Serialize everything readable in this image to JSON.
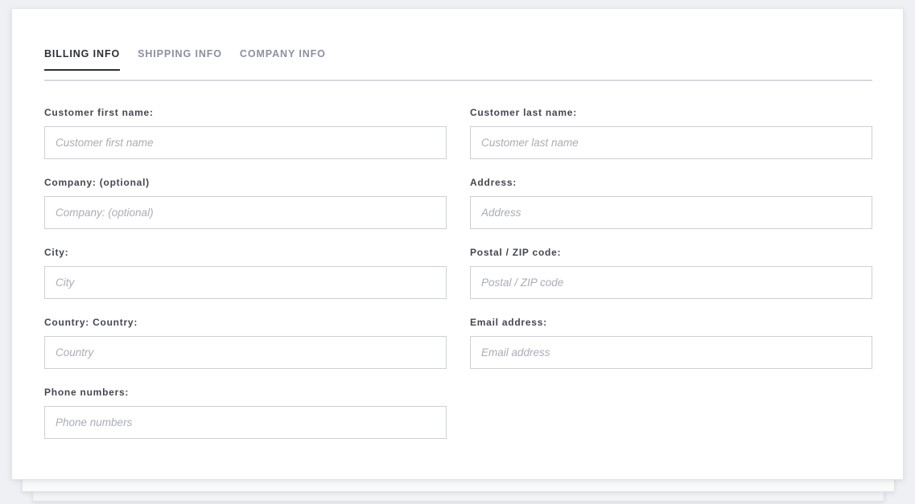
{
  "tabs": [
    {
      "label": "BILLING INFO",
      "name": "tab-billing-info",
      "active": true
    },
    {
      "label": "SHIPPING INFO",
      "name": "tab-shipping-info",
      "active": false
    },
    {
      "label": "COMPANY INFO",
      "name": "tab-company-info",
      "active": false
    }
  ],
  "form": {
    "left_column": [
      {
        "name": "customer-first-name",
        "label": "Customer first name:",
        "placeholder": "Customer first name",
        "value": ""
      },
      {
        "name": "company-optional",
        "label": "Company: (optional)",
        "placeholder": "Company: (optional)",
        "value": ""
      },
      {
        "name": "city",
        "label": "City:",
        "placeholder": "City",
        "value": ""
      },
      {
        "name": "country",
        "label": "Country: Country:",
        "placeholder": "Country",
        "value": ""
      },
      {
        "name": "phone-numbers",
        "label": "Phone numbers:",
        "placeholder": "Phone numbers",
        "value": ""
      }
    ],
    "right_column": [
      {
        "name": "customer-last-name",
        "label": "Customer last name:",
        "placeholder": "Customer last name",
        "value": ""
      },
      {
        "name": "address",
        "label": "Address:",
        "placeholder": "Address",
        "value": ""
      },
      {
        "name": "postal-zip-code",
        "label": "Postal / ZIP code:",
        "placeholder": "Postal / ZIP code",
        "value": ""
      },
      {
        "name": "email-address",
        "label": "Email address:",
        "placeholder": "Email address",
        "value": ""
      }
    ]
  },
  "colors": {
    "page_background": "#eff0f4",
    "card_background": "#ffffff",
    "active_tab_text": "#2b2f38",
    "inactive_tab_text": "#8b8fa3",
    "active_tab_underline": "#2b3039",
    "tab_divider": "#d7d9e0",
    "label_text": "#44474f",
    "input_border": "#ccd0d7",
    "placeholder_text": "#a9adb6"
  }
}
